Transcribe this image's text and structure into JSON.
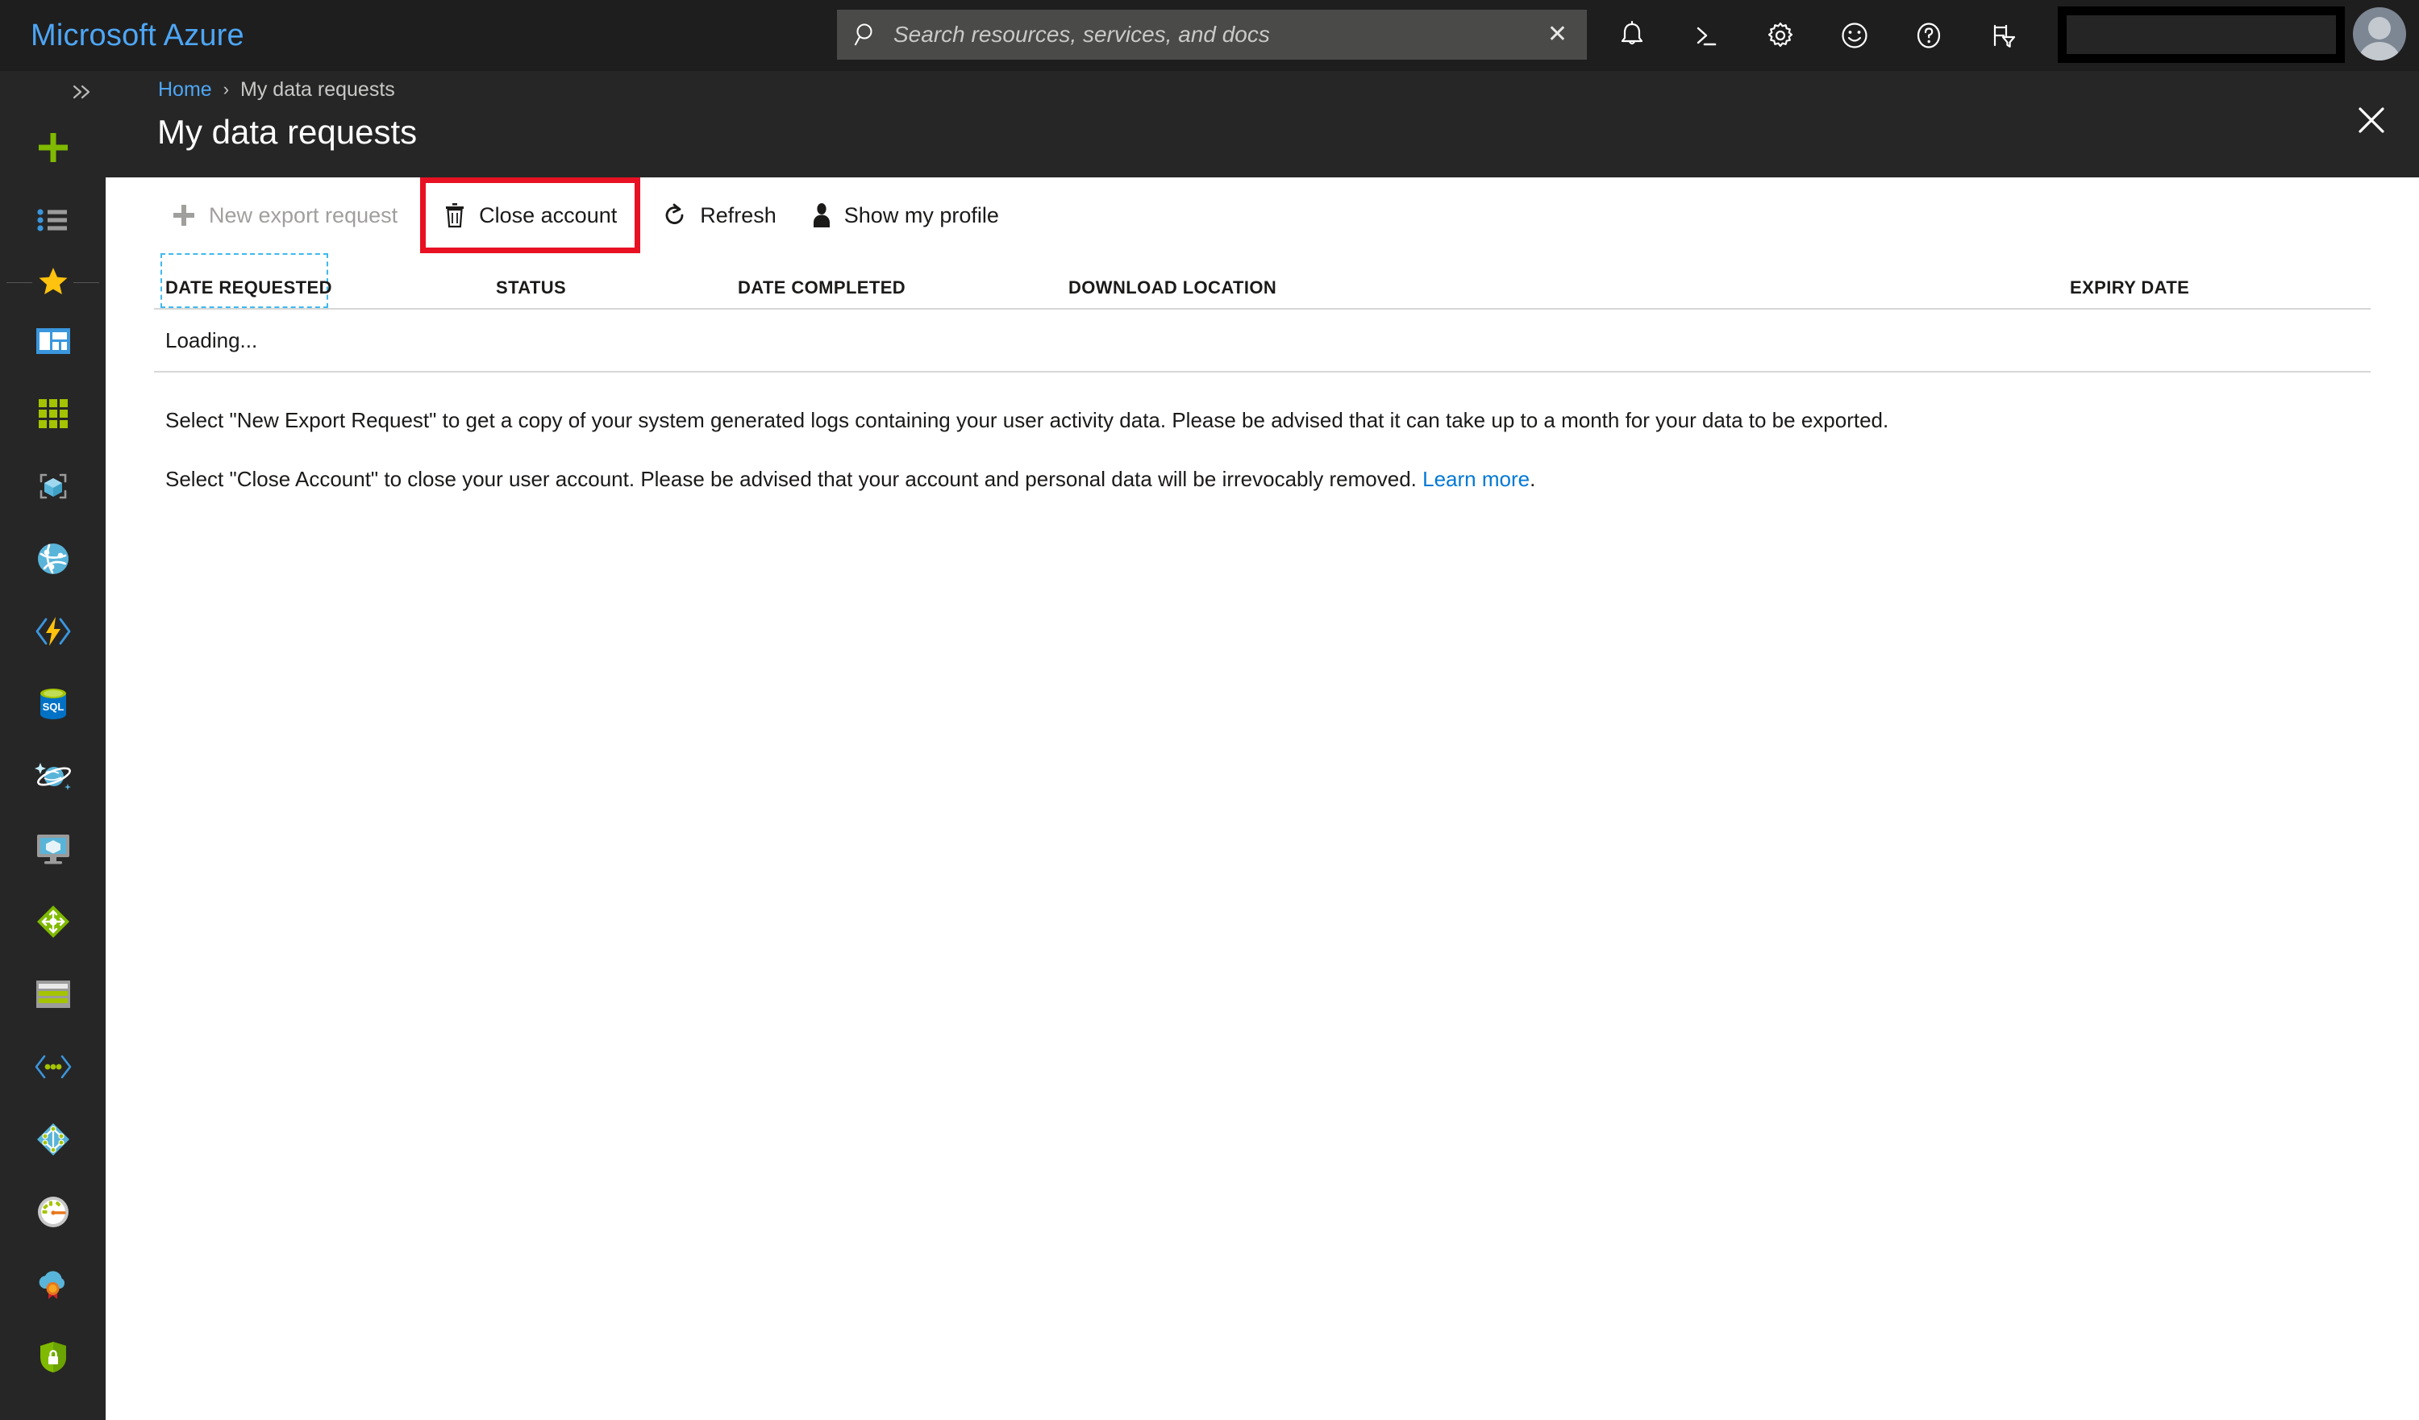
{
  "header": {
    "brand": "Microsoft Azure",
    "search": {
      "placeholder": "Search resources, services, and docs",
      "value": "",
      "clear_label": "✕",
      "icon": "search-icon"
    },
    "icons": [
      {
        "name": "notifications-icon",
        "title": "Notifications"
      },
      {
        "name": "cloud-shell-icon",
        "title": "Cloud Shell"
      },
      {
        "name": "settings-gear-icon",
        "title": "Directory + subscription settings"
      },
      {
        "name": "feedback-smiley-icon",
        "title": "Feedback"
      },
      {
        "name": "help-question-icon",
        "title": "Help"
      },
      {
        "name": "directory-filter-icon",
        "title": "Directory and subscription filter"
      }
    ],
    "account_redacted": "",
    "avatar": "user-avatar"
  },
  "sidebar": {
    "collapse_label": "»",
    "items": [
      {
        "name": "create-a-resource",
        "icon": "plus-icon"
      },
      {
        "name": "all-services",
        "icon": "list-icon"
      },
      {
        "name": "favorites-divider",
        "icon": "star-icon"
      },
      {
        "name": "dashboard",
        "icon": "dashboard-icon"
      },
      {
        "name": "all-resources",
        "icon": "grid-icon"
      },
      {
        "name": "resource-groups",
        "icon": "cube-icon"
      },
      {
        "name": "app-services",
        "icon": "globe-network-icon"
      },
      {
        "name": "function-apps",
        "icon": "function-bolt-icon"
      },
      {
        "name": "sql-databases",
        "icon": "sql-database-icon"
      },
      {
        "name": "azure-cosmos-db",
        "icon": "cosmos-planet-icon"
      },
      {
        "name": "virtual-machines",
        "icon": "monitor-vm-icon"
      },
      {
        "name": "load-balancers",
        "icon": "load-balancer-icon"
      },
      {
        "name": "storage-accounts",
        "icon": "storage-icon"
      },
      {
        "name": "virtual-networks",
        "icon": "virtual-network-icon"
      },
      {
        "name": "azure-active-directory",
        "icon": "aad-diamond-icon"
      },
      {
        "name": "monitor",
        "icon": "gauge-icon"
      },
      {
        "name": "advisor",
        "icon": "advisor-cloud-badge-icon"
      },
      {
        "name": "security-center",
        "icon": "shield-lock-icon"
      }
    ]
  },
  "blade": {
    "breadcrumb": {
      "home": "Home",
      "separator": "›",
      "current": "My data requests"
    },
    "title": "My data requests",
    "close_label": "✕"
  },
  "toolbar": {
    "new_export_request": "New export request",
    "close_account": "Close account",
    "refresh": "Refresh",
    "show_my_profile": "Show my profile"
  },
  "table": {
    "columns": [
      "DATE REQUESTED",
      "STATUS",
      "DATE COMPLETED",
      "DOWNLOAD LOCATION",
      "EXPIRY DATE"
    ],
    "loading_text": "Loading...",
    "rows": []
  },
  "descriptions": {
    "p1": "Select \"New Export Request\" to get a copy of your system generated logs containing your user activity data. Please be advised that it can take up to a month for your data to be exported.",
    "p2_before_link": "Select \"Close Account\" to close your user account. Please be advised that your account and personal data will be irrevocably removed. ",
    "p2_link": "Learn more",
    "p2_after_link": "."
  },
  "colors": {
    "azure_blue": "#4da6f5",
    "link_blue": "#0078d4",
    "highlight_red": "#e81123",
    "focus_cyan": "#3fb8f0",
    "header_bg": "#1f1e1e",
    "sidebar_bg": "#262626",
    "blade_bg": "#ffffff"
  }
}
